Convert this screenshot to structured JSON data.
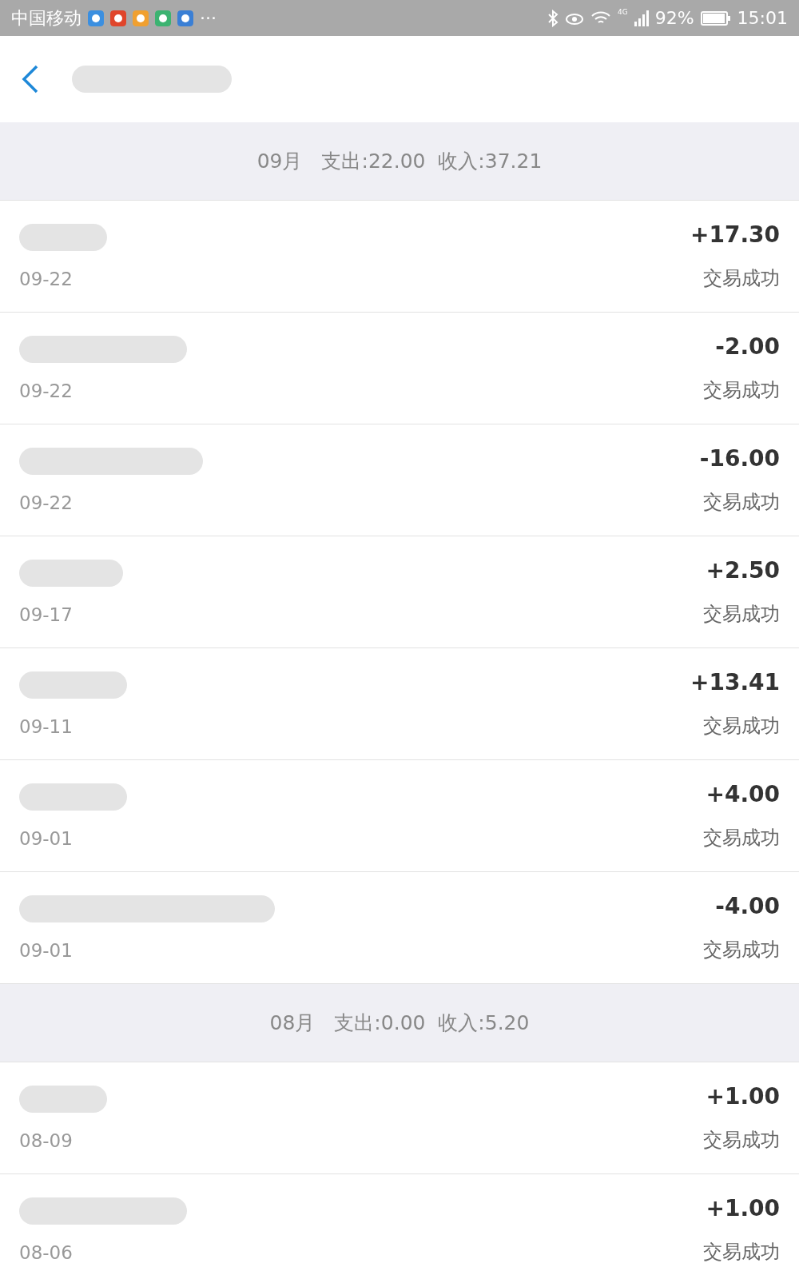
{
  "status_bar": {
    "carrier": "中国移动",
    "more": "···",
    "network": "4G",
    "battery": "92%",
    "time": "15:01"
  },
  "months": [
    {
      "month": "09月",
      "summary": "支出:22.00  收入:37.21",
      "rows": [
        {
          "date": "09-22",
          "amount": "+17.30",
          "status": "交易成功"
        },
        {
          "date": "09-22",
          "amount": "-2.00",
          "status": "交易成功"
        },
        {
          "date": "09-22",
          "amount": "-16.00",
          "status": "交易成功"
        },
        {
          "date": "09-17",
          "amount": "+2.50",
          "status": "交易成功"
        },
        {
          "date": "09-11",
          "amount": "+13.41",
          "status": "交易成功"
        },
        {
          "date": "09-01",
          "amount": "+4.00",
          "status": "交易成功"
        },
        {
          "date": "09-01",
          "amount": "-4.00",
          "status": "交易成功"
        }
      ]
    },
    {
      "month": "08月",
      "summary": "支出:0.00  收入:5.20",
      "rows": [
        {
          "date": "08-09",
          "amount": "+1.00",
          "status": "交易成功"
        },
        {
          "date": "08-06",
          "amount": "+1.00",
          "status": "交易成功"
        }
      ]
    }
  ]
}
